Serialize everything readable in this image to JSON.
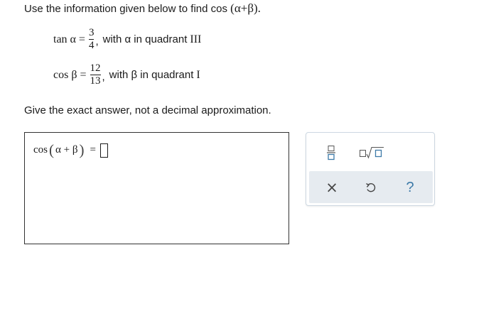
{
  "question": {
    "prompt_prefix": "Use the information given below to find cos",
    "prompt_expr": "(α+β).",
    "given": [
      {
        "fn": "tan α =",
        "numerator": "3",
        "denominator": "4",
        "tail_prefix": "with α in quadrant",
        "tail_quadrant": "III"
      },
      {
        "fn": "cos β =",
        "numerator": "12",
        "denominator": "13",
        "tail_prefix": "with β in quadrant",
        "tail_quadrant": "I"
      }
    ],
    "instruction": "Give the exact answer, not a decimal approximation."
  },
  "answer": {
    "fn": "cos",
    "paren_open": "(",
    "inner": "α + β",
    "paren_close": ")",
    "equals": "="
  },
  "toolbox": {
    "tools": [
      {
        "name": "fraction-icon"
      },
      {
        "name": "square-root-icon"
      },
      {
        "name": "clear-icon",
        "glyph": "×"
      },
      {
        "name": "undo-icon"
      },
      {
        "name": "help-icon",
        "glyph": "?"
      }
    ],
    "colors": {
      "icon_blue": "#3d7aa8",
      "row_bg": "#e6ebf0",
      "border": "#cdd8e2"
    }
  }
}
